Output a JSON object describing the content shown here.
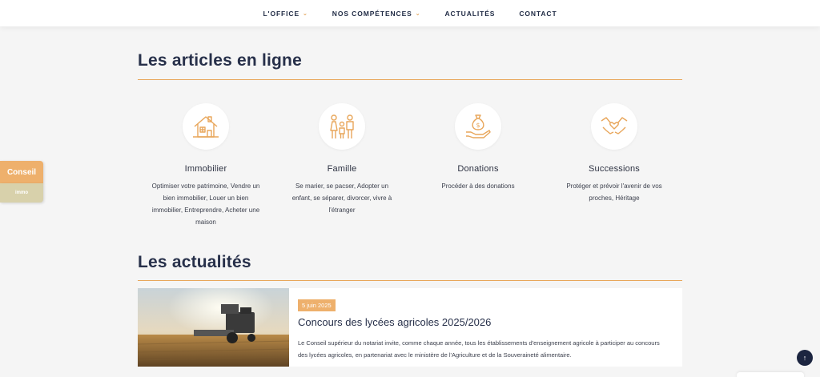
{
  "nav": {
    "items": [
      {
        "label": "L'OFFICE",
        "has_dropdown": true
      },
      {
        "label": "NOS COMPÉTENCES",
        "has_dropdown": true
      },
      {
        "label": "ACTUALITÉS",
        "has_dropdown": false
      },
      {
        "label": "CONTACT",
        "has_dropdown": false
      }
    ],
    "chevron_icon": "chevron-down-icon"
  },
  "articles": {
    "title": "Les articles en ligne",
    "cards": [
      {
        "icon": "house-icon",
        "title": "Immobilier",
        "desc": "Optimiser votre patrimoine, Vendre un bien immobilier, Louer un bien immobilier, Entreprendre, Acheter une maison"
      },
      {
        "icon": "family-icon",
        "title": "Famille",
        "desc": "Se marier, se pacser, Adopter un enfant, se séparer, divorcer, vivre à l'étranger"
      },
      {
        "icon": "money-bag-hand-icon",
        "title": "Donations",
        "desc": "Procéder à des donations"
      },
      {
        "icon": "handshake-heart-icon",
        "title": "Successions",
        "desc": "Protéger et prévoir l'avenir de vos proches, Héritage"
      }
    ]
  },
  "side_tab": {
    "conseil": "Conseil",
    "immo": "immo"
  },
  "news": {
    "title": "Les actualités",
    "items": [
      {
        "date": "5 juin 2025",
        "title": "Concours des lycées agricoles 2025/2026",
        "text": "Le Conseil supérieur du notariat invite, comme chaque année, tous les établissements d'enseignement agricole à participer au concours des lycées agricoles, en partenariat avec le ministère de l'Agriculture et de la Souveraineté alimentaire.",
        "image": "combine-harvester-photo"
      }
    ]
  },
  "back_to_top": {
    "icon": "arrow-up-icon",
    "glyph": "↑"
  },
  "colors": {
    "accent": "#e8a65a",
    "navy": "#1c2540",
    "background": "#f5f5f5"
  }
}
